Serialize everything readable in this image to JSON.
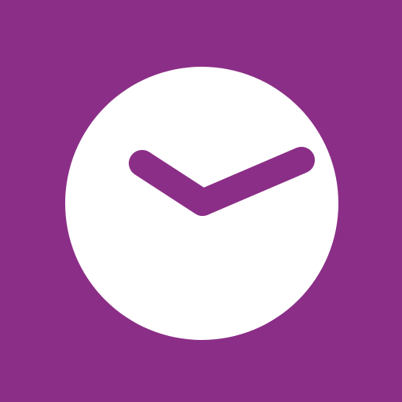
{
  "icon": {
    "name": "clock-icon",
    "colors": {
      "background": "#8b2e87",
      "face": "#ffffff",
      "hands": "#8b2e87"
    }
  }
}
